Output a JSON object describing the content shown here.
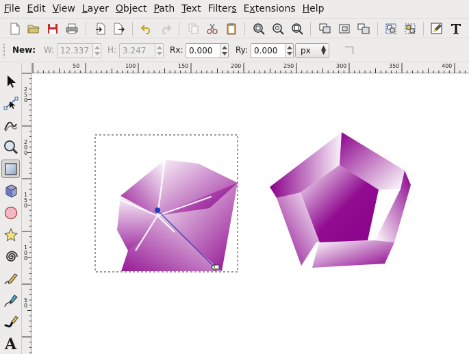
{
  "menubar": {
    "items": [
      {
        "label": "File",
        "acc": "F",
        "rest": "ile"
      },
      {
        "label": "Edit",
        "acc": "E",
        "rest": "dit"
      },
      {
        "label": "View",
        "acc": "V",
        "rest": "iew"
      },
      {
        "label": "Layer",
        "acc": "L",
        "rest": "ayer"
      },
      {
        "label": "Object",
        "acc": "O",
        "rest": "bject"
      },
      {
        "label": "Path",
        "acc": "P",
        "rest": "ath"
      },
      {
        "label": "Text",
        "acc": "T",
        "rest": "ext"
      },
      {
        "label": "Filters",
        "acc": "",
        "rest": "Filters",
        "pre": "Filter",
        "accmid": "s"
      },
      {
        "label": "Extensions",
        "acc": "",
        "rest": "Extensions",
        "pre": "E",
        "accmid": "x",
        "post": "tensions"
      },
      {
        "label": "Help",
        "acc": "H",
        "rest": "elp"
      }
    ]
  },
  "controls": {
    "new_label": "New:",
    "w_label": "W:",
    "w_value": "12.337",
    "h_label": "H:",
    "h_value": "3.247",
    "rx_label": "Rx:",
    "rx_value": "0.000",
    "ry_label": "Ry:",
    "ry_value": "0.000",
    "unit": "px"
  },
  "ruler": {
    "h_labels": [
      "50",
      "100",
      "150",
      "200",
      "250",
      "300",
      "350",
      "400"
    ],
    "v_labels": [
      "250",
      "200",
      "150",
      "100",
      "50"
    ]
  },
  "colors": {
    "accent": "#8b008b",
    "selection_dash": "#333333",
    "gradient_handle": "#1f3fbf"
  },
  "icons": {
    "toolbox": [
      "selector-arrow-icon",
      "node-editor-icon",
      "tweak-icon",
      "zoom-icon",
      "rectangle-icon",
      "3d-box-icon",
      "ellipse-icon",
      "star-icon",
      "spiral-icon",
      "pencil-icon",
      "pen-icon",
      "calligraphy-icon",
      "text-icon"
    ]
  }
}
